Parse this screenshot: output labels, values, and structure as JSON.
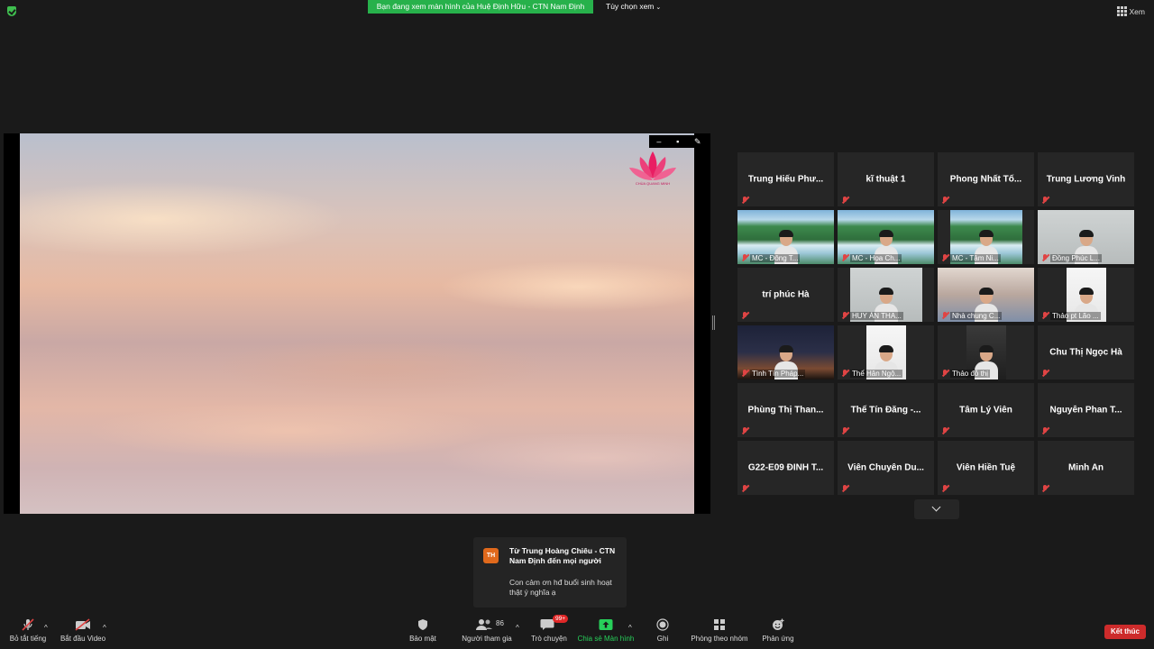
{
  "topbar": {
    "banner": "Bạn đang xem màn hình của Huệ Định Hữu - CTN Nam Định",
    "view_options": "Tùy chọn xem",
    "view": "Xem"
  },
  "logo": {
    "text": "CHÙA QUANG MINH"
  },
  "gallery": {
    "tiles": [
      {
        "name": "Trung Hiếu Phư..."
      },
      {
        "name": "kĩ thuật 1"
      },
      {
        "name": "Phong Nhất Tổ..."
      },
      {
        "name": "Trung Lương Vinh"
      },
      {
        "name": "MC - Đông T..."
      },
      {
        "name": "MC - Họa Ch..."
      },
      {
        "name": "MC - Tâm Ni..."
      },
      {
        "name": "Đồng Phúc L..."
      },
      {
        "name": "trí phúc Hà"
      },
      {
        "name": "HUY ÁN THA..."
      },
      {
        "name": "Nhà chung C..."
      },
      {
        "name": "Thảo pt Lão ..."
      },
      {
        "name": "Tình Tín Pháp..."
      },
      {
        "name": "Thể Hân Ngộ..."
      },
      {
        "name": "Thảo đỗ thị"
      },
      {
        "name": "Chu Thị Ngọc Hà"
      },
      {
        "name": "Phùng Thị Than..."
      },
      {
        "name": "Thể Tín Đăng -..."
      },
      {
        "name": "Tâm Lý Viên"
      },
      {
        "name": "Nguyễn Phan T..."
      },
      {
        "name": "G22-E09 ĐINH T..."
      },
      {
        "name": "Viên Chuyên Du..."
      },
      {
        "name": "Viên Hiền Tuệ"
      },
      {
        "name": "Minh An"
      }
    ]
  },
  "chat": {
    "avatar": "TH",
    "from": "Từ Trung Hoàng Chiêu - CTN Nam Định đến mọi người",
    "message": "Con cảm ơn hđ buổi sinh hoạt thật ý nghĩa ạ"
  },
  "toolbar": {
    "mute": "Bỏ tắt tiếng",
    "video": "Bắt đầu Video",
    "security": "Bảo mật",
    "participants": "Người tham gia",
    "participants_count": "86",
    "chat": "Trò chuyện",
    "chat_badge": "99+",
    "share": "Chia sẻ Màn hình",
    "record": "Ghi",
    "breakout": "Phòng theo nhóm",
    "reactions": "Phản ứng",
    "end": "Kết thúc"
  },
  "colors": {
    "share_banner": "#27b14b",
    "end_button": "#cd2b2b",
    "active_speaker": "#c6e07f",
    "muted_icon": "#e04444"
  }
}
